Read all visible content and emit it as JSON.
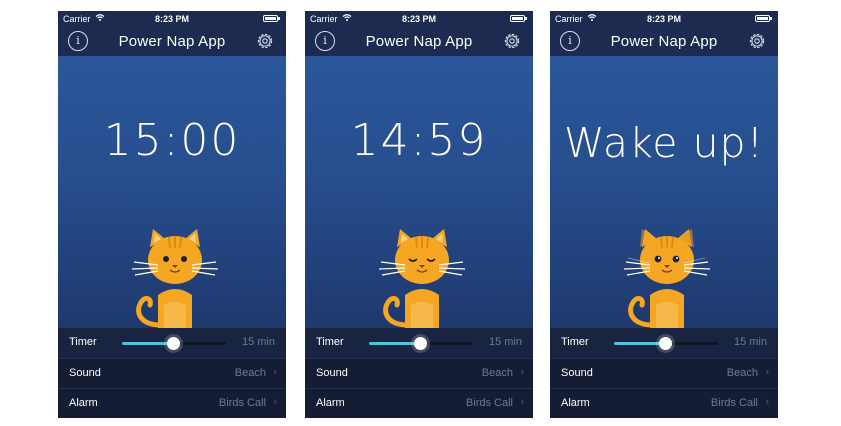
{
  "app_title": "Power Nap App",
  "screens": [
    {
      "status": {
        "carrier": "Carrier",
        "time": "8:23 PM"
      },
      "display_text": "15:00",
      "cat_state": "awake",
      "settings": {
        "timer": {
          "label": "Timer",
          "value": "15 min",
          "slider_level": 0.5
        },
        "sound": {
          "label": "Sound",
          "value": "Beach"
        },
        "alarm": {
          "label": "Alarm",
          "value": "Birds Call"
        }
      }
    },
    {
      "status": {
        "carrier": "Carrier",
        "time": "8:23 PM"
      },
      "display_text": "14:59",
      "cat_state": "sleeping",
      "settings": {
        "timer": {
          "label": "Timer",
          "value": "15 min",
          "slider_level": 0.5
        },
        "sound": {
          "label": "Sound",
          "value": "Beach"
        },
        "alarm": {
          "label": "Alarm",
          "value": "Birds Call"
        }
      }
    },
    {
      "status": {
        "carrier": "Carrier",
        "time": "8:23 PM"
      },
      "display_text": "Wake up!",
      "cat_state": "waking",
      "settings": {
        "timer": {
          "label": "Timer",
          "value": "15 min",
          "slider_level": 0.5
        },
        "sound": {
          "label": "Sound",
          "value": "Beach"
        },
        "alarm": {
          "label": "Alarm",
          "value": "Birds Call"
        }
      }
    }
  ],
  "icons": {
    "info": "info-icon",
    "settings": "gear-icon",
    "disclosure": "chevron-right-icon",
    "wifi": "wifi-icon",
    "battery": "battery-icon"
  },
  "colors": {
    "nav_bar": "#1c2b4f",
    "accent": "#4fc3d6",
    "cat_orange": "#f5a623",
    "settings_bg": "#141d33"
  }
}
